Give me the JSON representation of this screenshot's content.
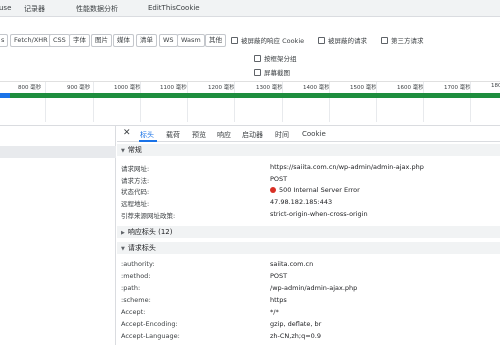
{
  "top_tabs": [
    "use",
    "记录器",
    "性能数据分析",
    "EditThisCookie"
  ],
  "filter_chips": [
    "s",
    "Fetch/XHR",
    "CSS",
    "字体",
    "图片",
    "媒体",
    "清单",
    "WS",
    "Wasm",
    "其他"
  ],
  "filter_checkboxes": [
    "被屏蔽的响应 Cookie",
    "被屏蔽的请求",
    "第三方请求"
  ],
  "options": [
    "按框架分组",
    "屏幕截图"
  ],
  "timeline_ticks": [
    "800 毫秒",
    "900 毫秒",
    "1000 毫秒",
    "1100 毫秒",
    "1200 毫秒",
    "1300 毫秒",
    "1400 毫秒",
    "1500 毫秒",
    "1600 毫秒",
    "1700 毫秒",
    "180"
  ],
  "detail": {
    "close_icon": "close-icon",
    "tabs": [
      "标头",
      "载荷",
      "预览",
      "响应",
      "启动器",
      "时间",
      "Cookie"
    ],
    "active_tab": "标头",
    "sections": {
      "general": "常规",
      "response_headers": "响应标头 (12)",
      "request_headers": "请求标头"
    },
    "general_rows": [
      {
        "key": "请求网址:",
        "value": "https://saiita.com.cn/wp-admin/admin-ajax.php"
      },
      {
        "key": "请求方法:",
        "value": "POST"
      },
      {
        "key": "状态代码:",
        "value": "500 Internal Server Error"
      },
      {
        "key": "远程地址:",
        "value": "47.98.182.185:443"
      },
      {
        "key": "引荐来源网址政策:",
        "value": "strict-origin-when-cross-origin"
      }
    ],
    "request_header_rows": [
      {
        "key": ":authority:",
        "value": "saiita.com.cn"
      },
      {
        "key": ":method:",
        "value": "POST"
      },
      {
        "key": ":path:",
        "value": "/wp-admin/admin-ajax.php"
      },
      {
        "key": ":scheme:",
        "value": "https"
      },
      {
        "key": "Accept:",
        "value": "*/*"
      },
      {
        "key": "Accept-Encoding:",
        "value": "gzip, deflate, br"
      },
      {
        "key": "Accept-Language:",
        "value": "zh-CN,zh;q=0.9"
      }
    ]
  },
  "colors": {
    "accent": "#1a73e8",
    "status_error": "#d93025",
    "timeline_green": "#1e8e3e"
  }
}
